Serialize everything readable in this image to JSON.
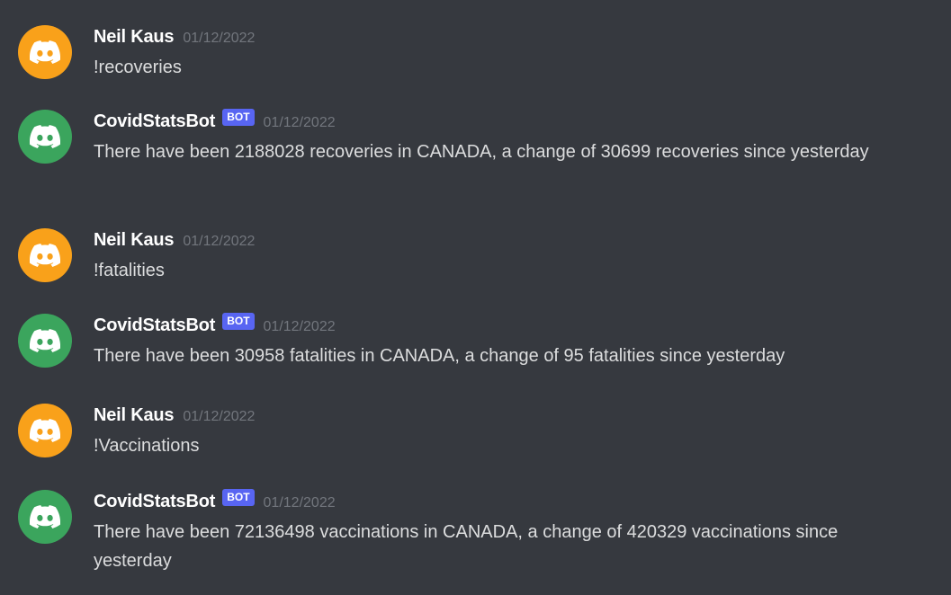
{
  "colors": {
    "background": "#36393f",
    "user_avatar": "#f9a11a",
    "bot_avatar": "#3ba55d",
    "bot_tag": "#5865f2",
    "username": "#ffffff",
    "timestamp": "#72767d",
    "message_text": "#dcddde"
  },
  "messages": [
    {
      "author": "Neil Kaus",
      "is_bot": false,
      "avatar_icon": "discord-logo-icon",
      "timestamp": "01/12/2022",
      "text": "!recoveries"
    },
    {
      "author": "CovidStatsBot",
      "is_bot": true,
      "bot_tag": "BOT",
      "avatar_icon": "discord-logo-icon",
      "timestamp": "01/12/2022",
      "text": "There have been 2188028 recoveries in CANADA, a change of 30699 recoveries since yesterday"
    },
    {
      "author": "Neil Kaus",
      "is_bot": false,
      "avatar_icon": "discord-logo-icon",
      "timestamp": "01/12/2022",
      "text": "!fatalities"
    },
    {
      "author": "CovidStatsBot",
      "is_bot": true,
      "bot_tag": "BOT",
      "avatar_icon": "discord-logo-icon",
      "timestamp": "01/12/2022",
      "text": "There have been 30958 fatalities in CANADA, a change of 95 fatalities since yesterday"
    },
    {
      "author": "Neil Kaus",
      "is_bot": false,
      "avatar_icon": "discord-logo-icon",
      "timestamp": "01/12/2022",
      "text": "!Vaccinations"
    },
    {
      "author": "CovidStatsBot",
      "is_bot": true,
      "bot_tag": "BOT",
      "avatar_icon": "discord-logo-icon",
      "timestamp": "01/12/2022",
      "text": "There have been 72136498 vaccinations in CANADA, a change of 420329 vaccinations since yesterday"
    }
  ]
}
